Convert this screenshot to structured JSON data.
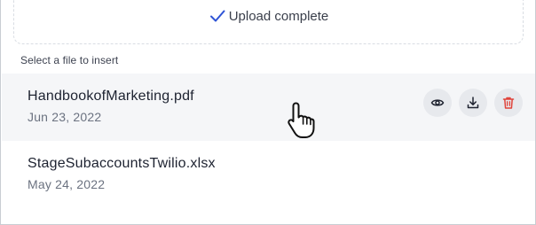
{
  "upload": {
    "status_text": "Upload complete",
    "status_icon": "check-icon",
    "accent_color": "#2f54d6"
  },
  "section_label": "Select a file to insert",
  "files": [
    {
      "name": "HandbookofMarketing.pdf",
      "date": "Jun 23, 2022",
      "hovered": true
    },
    {
      "name": "StageSubaccountsTwilio.xlsx",
      "date": "May 24, 2022",
      "hovered": false
    }
  ],
  "row_actions": [
    {
      "icon": "eye-icon",
      "action": "preview"
    },
    {
      "icon": "download-icon",
      "action": "download"
    },
    {
      "icon": "trash-icon",
      "action": "delete",
      "color": "#e0433a"
    }
  ]
}
